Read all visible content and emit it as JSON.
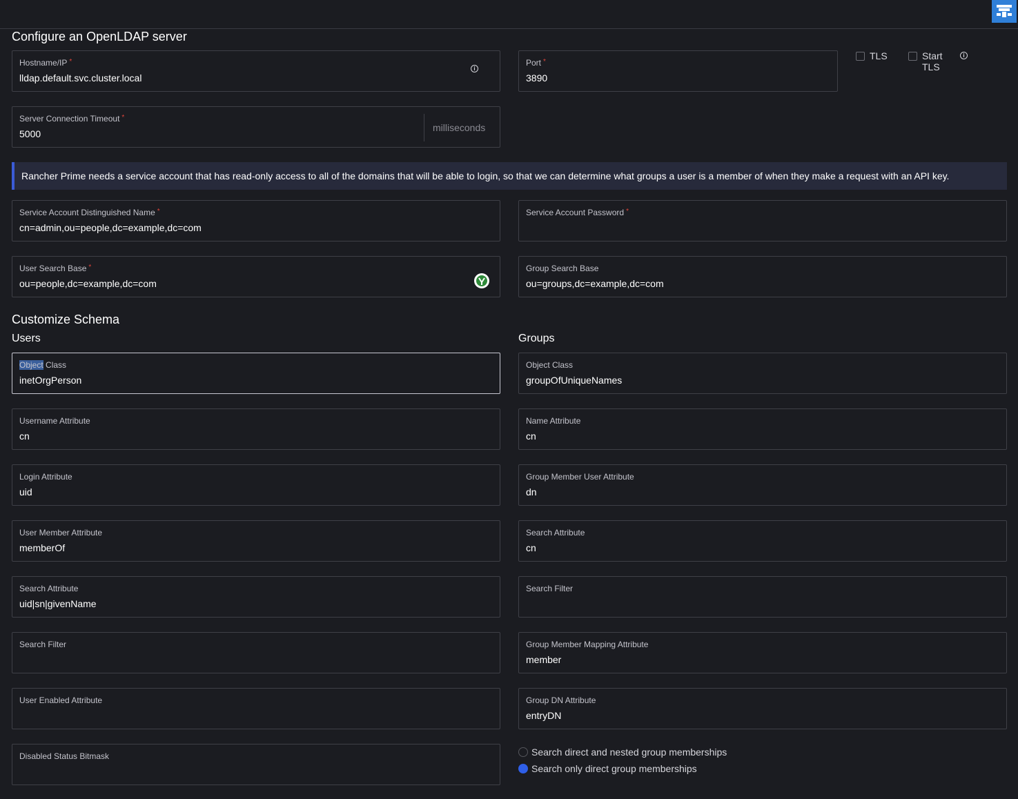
{
  "header": {
    "logo_icon": "rancher-logo-icon"
  },
  "server": {
    "title": "Configure an OpenLDAP server",
    "hostname": {
      "label": "Hostname/IP",
      "required": "*",
      "value": "lldap.default.svc.cluster.local"
    },
    "port": {
      "label": "Port",
      "required": "*",
      "value": "3890"
    },
    "tls_label": "TLS",
    "start_tls_label": "Start TLS",
    "start_tls_line1": "Start",
    "start_tls_line2": "TLS",
    "timeout": {
      "label": "Server Connection Timeout",
      "required": "*",
      "value": "5000",
      "suffix": "milliseconds"
    }
  },
  "banner": "Rancher Prime needs a service account that has read-only access to all of the domains that will be able to login, so that we can determine what groups a user is a member of when they make a request with an API key.",
  "service_account": {
    "dn": {
      "label": "Service Account Distinguished Name",
      "required": "*",
      "value": "cn=admin,ou=people,dc=example,dc=com"
    },
    "password": {
      "label": "Service Account Password",
      "required": "*",
      "value": ""
    },
    "user_search_base": {
      "label": "User Search Base",
      "required": "*",
      "value": "ou=people,dc=example,dc=com"
    },
    "group_search_base": {
      "label": "Group Search Base",
      "value": "ou=groups,dc=example,dc=com"
    }
  },
  "schema": {
    "title": "Customize Schema",
    "users": {
      "heading": "Users",
      "object_class": {
        "label_part1": "Object",
        "label_part2": " Class",
        "value": "inetOrgPerson"
      },
      "username_attribute": {
        "label": "Username Attribute",
        "value": "cn"
      },
      "login_attribute": {
        "label": "Login Attribute",
        "value": "uid"
      },
      "user_member_attribute": {
        "label": "User Member Attribute",
        "value": "memberOf"
      },
      "search_attribute": {
        "label": "Search Attribute",
        "value": "uid|sn|givenName"
      },
      "search_filter": {
        "label": "Search Filter",
        "value": ""
      },
      "user_enabled_attribute": {
        "label": "User Enabled Attribute",
        "value": ""
      },
      "disabled_status_bitmask": {
        "label": "Disabled Status Bitmask",
        "value": ""
      }
    },
    "groups": {
      "heading": "Groups",
      "object_class": {
        "label": "Object Class",
        "value": "groupOfUniqueNames"
      },
      "name_attribute": {
        "label": "Name Attribute",
        "value": "cn"
      },
      "group_member_user_attribute": {
        "label": "Group Member User Attribute",
        "value": "dn"
      },
      "search_attribute": {
        "label": "Search Attribute",
        "value": "cn"
      },
      "search_filter": {
        "label": "Search Filter",
        "value": ""
      },
      "group_member_mapping_attribute": {
        "label": "Group Member Mapping Attribute",
        "value": "member"
      },
      "group_dn_attribute": {
        "label": "Group DN Attribute",
        "value": "entryDN"
      },
      "membership_options": [
        {
          "label": "Search direct and nested group memberships",
          "selected": false
        },
        {
          "label": "Search only direct group memberships",
          "selected": true
        }
      ]
    }
  },
  "colors": {
    "background": "#1b1c21",
    "accent": "#2f5fe8",
    "banner_bg": "#272a3b",
    "required": "#e0453b"
  }
}
